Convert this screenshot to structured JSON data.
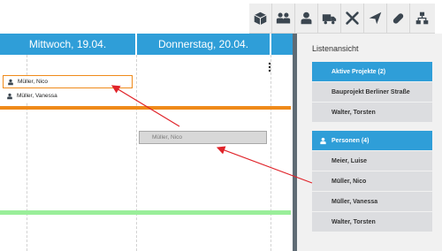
{
  "calendar": {
    "days": [
      {
        "label": "Mittwoch, 19.04."
      },
      {
        "label": "Donnerstag, 20.04."
      }
    ],
    "events": [
      {
        "name": "Müller, Nico",
        "selected": true
      },
      {
        "name": "Müller, Vanessa",
        "selected": false
      }
    ],
    "ghost_event": {
      "name": "Müller, Nico"
    },
    "colors": {
      "header": "#2f9ed8",
      "orange_line": "#ef8a1a",
      "green_line": "#9aee9a",
      "arrow": "#e0242a"
    }
  },
  "toolbar": {
    "icons": [
      "box-icon",
      "team-icon",
      "person-icon",
      "truck-icon",
      "tools-icon",
      "send-icon",
      "pill-icon",
      "hierarchy-icon"
    ]
  },
  "panel": {
    "title": "Listenansicht",
    "projects_header": "Aktive Projekte (2)",
    "projects": [
      "Bauprojekt Berliner Straße",
      "Walter, Torsten"
    ],
    "persons_header": "Personen (4)",
    "persons": [
      "Meier, Luise",
      "Müller, Nico",
      "Müller, Vanessa",
      "Walter, Torsten"
    ]
  }
}
